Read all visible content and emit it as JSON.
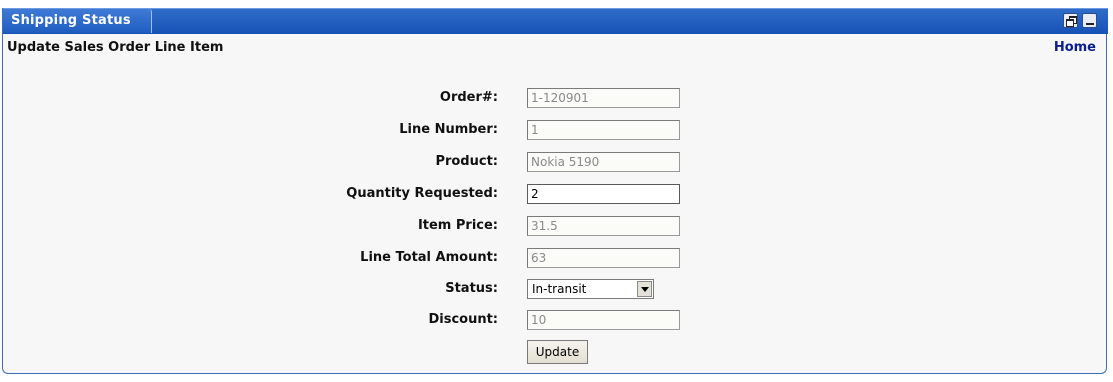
{
  "portlet": {
    "title": "Shipping Status"
  },
  "header": {
    "heading": "Update Sales Order Line Item",
    "home_link": "Home"
  },
  "form": {
    "fields": [
      {
        "label": "Order#:",
        "value": "1-120901",
        "editable": false
      },
      {
        "label": "Line Number:",
        "value": "1",
        "editable": false
      },
      {
        "label": "Product:",
        "value": "Nokia 5190",
        "editable": false
      },
      {
        "label": "Quantity Requested:",
        "value": "2",
        "editable": true
      },
      {
        "label": "Item Price:",
        "value": "31.5",
        "editable": false
      },
      {
        "label": "Line Total Amount:",
        "value": "63",
        "editable": false
      },
      {
        "label": "Status:",
        "value": "In-transit",
        "type": "select"
      },
      {
        "label": "Discount:",
        "value": "10",
        "editable": false
      }
    ],
    "submit_label": "Update"
  },
  "icons": {
    "restore": "restore-window-icon",
    "minimize": "minimize-window-icon"
  },
  "colors": {
    "titlebar": "#1753b5",
    "link": "#0a1f8f"
  }
}
